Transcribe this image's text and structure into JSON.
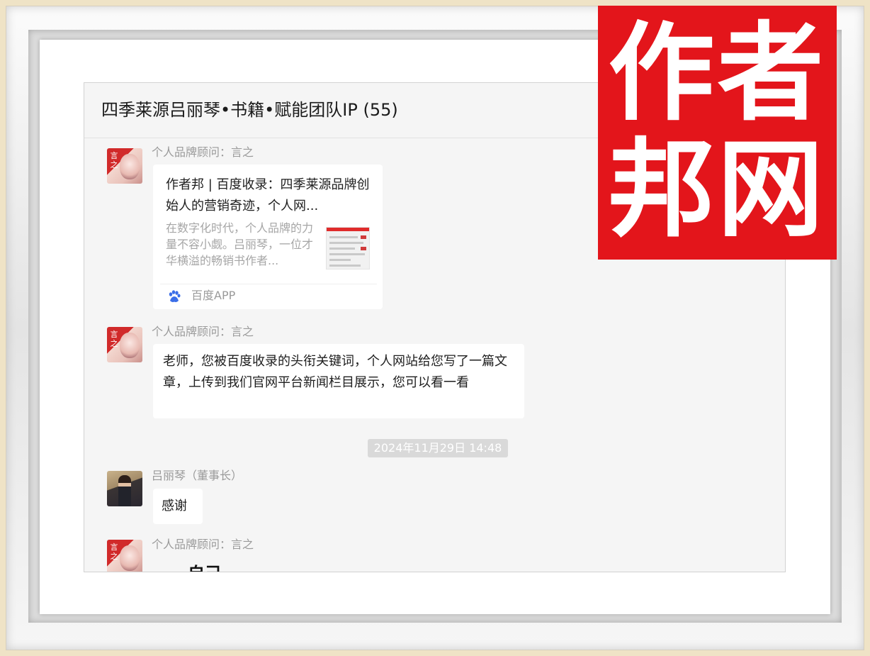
{
  "chat": {
    "title": "四季莱源吕丽琴•书籍•赋能团队IP (55)"
  },
  "messages": [
    {
      "sender": "个人品牌顾问：言之",
      "avatar_seal": "言之",
      "card": {
        "title": "作者邦 | 百度收录：四季莱源品牌创始人的营销奇迹，个人网...",
        "description": "在数字化时代，个人品牌的力量不容小觑。吕丽琴，一位才华横溢的畅销书作者...",
        "source": "百度APP"
      }
    },
    {
      "sender": "个人品牌顾问：言之",
      "avatar_seal": "言之",
      "text": "老师，您被百度收录的头衔关键词，个人网站给您写了一篇文章，上传到我们官网平台新闻栏目展示，您可以看一看"
    },
    {
      "sender": "吕丽琴（董事长）",
      "text": "感谢"
    },
    {
      "sender": "个人品牌顾问：言之",
      "avatar_seal": "言之",
      "partial_text": "自己"
    }
  ],
  "timestamp": "2024年11月29日 14:48",
  "watermark": {
    "line1": "作者",
    "line2": "邦网"
  },
  "colors": {
    "watermark_red": "#e3151b",
    "chat_bg": "#f5f5f5",
    "bubble_bg": "#ffffff",
    "frame_beige": "#efe3c6"
  }
}
